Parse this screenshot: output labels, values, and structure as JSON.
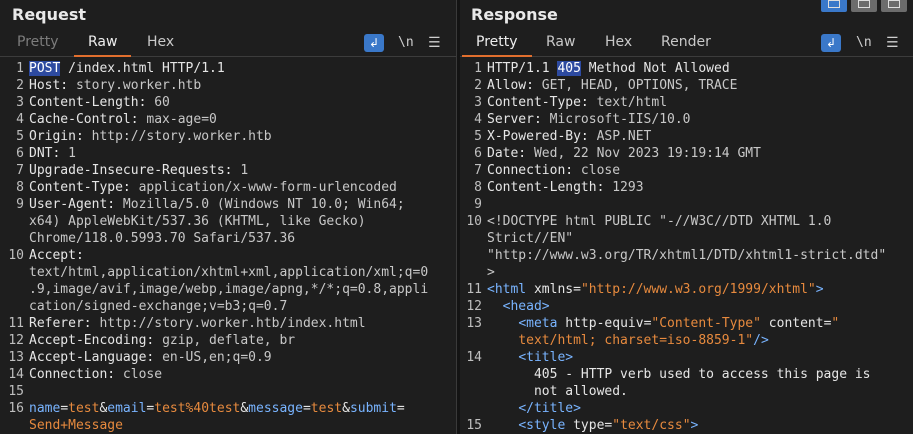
{
  "request": {
    "title": "Request",
    "tabs": [
      "Pretty",
      "Raw",
      "Hex"
    ],
    "active_tab": "Raw",
    "newline_label": "\\n",
    "lines": [
      {
        "n": "1",
        "segs": [
          {
            "t": "POST",
            "c": "hl"
          },
          {
            "t": " /index.html HTTP/1.1",
            "c": "k"
          }
        ]
      },
      {
        "n": "2",
        "segs": [
          {
            "t": "Host: ",
            "c": "k"
          },
          {
            "t": "story.worker.htb",
            "c": "v"
          }
        ]
      },
      {
        "n": "3",
        "segs": [
          {
            "t": "Content-Length: ",
            "c": "k"
          },
          {
            "t": "60",
            "c": "v"
          }
        ]
      },
      {
        "n": "4",
        "segs": [
          {
            "t": "Cache-Control: ",
            "c": "k"
          },
          {
            "t": "max-age=0",
            "c": "v"
          }
        ]
      },
      {
        "n": "5",
        "segs": [
          {
            "t": "Origin: ",
            "c": "k"
          },
          {
            "t": "http://story.worker.htb",
            "c": "v"
          }
        ]
      },
      {
        "n": "6",
        "segs": [
          {
            "t": "DNT: ",
            "c": "k"
          },
          {
            "t": "1",
            "c": "v"
          }
        ]
      },
      {
        "n": "7",
        "segs": [
          {
            "t": "Upgrade-Insecure-Requests: ",
            "c": "k"
          },
          {
            "t": "1",
            "c": "v"
          }
        ]
      },
      {
        "n": "8",
        "segs": [
          {
            "t": "Content-Type: ",
            "c": "k"
          },
          {
            "t": "application/x-www-form-urlencoded",
            "c": "v"
          }
        ]
      },
      {
        "n": "9",
        "segs": [
          {
            "t": "User-Agent: ",
            "c": "k"
          },
          {
            "t": "Mozilla/5.0 (Windows NT 10.0; Win64;",
            "c": "v"
          }
        ]
      },
      {
        "n": "",
        "segs": [
          {
            "t": "x64) AppleWebKit/537.36 (KHTML, like Gecko)",
            "c": "v"
          }
        ]
      },
      {
        "n": "",
        "segs": [
          {
            "t": "Chrome/118.0.5993.70 Safari/537.36",
            "c": "v"
          }
        ]
      },
      {
        "n": "10",
        "segs": [
          {
            "t": "Accept:",
            "c": "k"
          }
        ]
      },
      {
        "n": "",
        "segs": [
          {
            "t": "text/html,application/xhtml+xml,application/xml;q=0",
            "c": "v"
          }
        ]
      },
      {
        "n": "",
        "segs": [
          {
            "t": ".9,image/avif,image/webp,image/apng,*/*;q=0.8,appli",
            "c": "v"
          }
        ]
      },
      {
        "n": "",
        "segs": [
          {
            "t": "cation/signed-exchange;v=b3;q=0.7",
            "c": "v"
          }
        ]
      },
      {
        "n": "11",
        "segs": [
          {
            "t": "Referer: ",
            "c": "k"
          },
          {
            "t": "http://story.worker.htb/index.html",
            "c": "v"
          }
        ]
      },
      {
        "n": "12",
        "segs": [
          {
            "t": "Accept-Encoding: ",
            "c": "k"
          },
          {
            "t": "gzip, deflate, br",
            "c": "v"
          }
        ]
      },
      {
        "n": "13",
        "segs": [
          {
            "t": "Accept-Language: ",
            "c": "k"
          },
          {
            "t": "en-US,en;q=0.9",
            "c": "v"
          }
        ]
      },
      {
        "n": "14",
        "segs": [
          {
            "t": "Connection: ",
            "c": "k"
          },
          {
            "t": "close",
            "c": "v"
          }
        ]
      },
      {
        "n": "15",
        "segs": []
      },
      {
        "n": "16",
        "segs": [
          {
            "t": "name",
            "c": "pn"
          },
          {
            "t": "=",
            "c": "k"
          },
          {
            "t": "test",
            "c": "pv"
          },
          {
            "t": "&",
            "c": "k"
          },
          {
            "t": "email",
            "c": "pn"
          },
          {
            "t": "=",
            "c": "k"
          },
          {
            "t": "test%40test",
            "c": "pv"
          },
          {
            "t": "&",
            "c": "k"
          },
          {
            "t": "message",
            "c": "pn"
          },
          {
            "t": "=",
            "c": "k"
          },
          {
            "t": "test",
            "c": "pv"
          },
          {
            "t": "&",
            "c": "k"
          },
          {
            "t": "submit",
            "c": "pn"
          },
          {
            "t": "=",
            "c": "k"
          }
        ]
      },
      {
        "n": "",
        "segs": [
          {
            "t": "Send+Message",
            "c": "pv"
          }
        ]
      }
    ]
  },
  "response": {
    "title": "Response",
    "tabs": [
      "Pretty",
      "Raw",
      "Hex",
      "Render"
    ],
    "active_tab": "Pretty",
    "newline_label": "\\n",
    "lines": [
      {
        "n": "1",
        "segs": [
          {
            "t": "HTTP/1.1 ",
            "c": "k"
          },
          {
            "t": "405",
            "c": "hl"
          },
          {
            "t": " Method Not Allowed",
            "c": "k"
          }
        ]
      },
      {
        "n": "2",
        "segs": [
          {
            "t": "Allow: ",
            "c": "k"
          },
          {
            "t": "GET, HEAD, OPTIONS, TRACE",
            "c": "v"
          }
        ]
      },
      {
        "n": "3",
        "segs": [
          {
            "t": "Content-Type: ",
            "c": "k"
          },
          {
            "t": "text/html",
            "c": "v"
          }
        ]
      },
      {
        "n": "4",
        "segs": [
          {
            "t": "Server: ",
            "c": "k"
          },
          {
            "t": "Microsoft-IIS/10.0",
            "c": "v"
          }
        ]
      },
      {
        "n": "5",
        "segs": [
          {
            "t": "X-Powered-By: ",
            "c": "k"
          },
          {
            "t": "ASP.NET",
            "c": "v"
          }
        ]
      },
      {
        "n": "6",
        "segs": [
          {
            "t": "Date: ",
            "c": "k"
          },
          {
            "t": "Wed, 22 Nov 2023 19:19:14 GMT",
            "c": "v"
          }
        ]
      },
      {
        "n": "7",
        "segs": [
          {
            "t": "Connection: ",
            "c": "k"
          },
          {
            "t": "close",
            "c": "v"
          }
        ]
      },
      {
        "n": "8",
        "segs": [
          {
            "t": "Content-Length: ",
            "c": "k"
          },
          {
            "t": "1293",
            "c": "v"
          }
        ]
      },
      {
        "n": "9",
        "segs": []
      },
      {
        "n": "10",
        "segs": [
          {
            "t": "<!DOCTYPE html PUBLIC \"-//W3C//DTD XHTML 1.0",
            "c": "v"
          }
        ]
      },
      {
        "n": "",
        "segs": [
          {
            "t": "Strict//EN\"",
            "c": "v"
          }
        ]
      },
      {
        "n": "",
        "segs": [
          {
            "t": "\"http://www.w3.org/TR/xhtml1/DTD/xhtml1-strict.dtd\"",
            "c": "v"
          }
        ]
      },
      {
        "n": "",
        "segs": [
          {
            "t": ">",
            "c": "v"
          }
        ]
      },
      {
        "n": "11",
        "segs": [
          {
            "t": "<html ",
            "c": "tag"
          },
          {
            "t": "xmlns",
            "c": "attr"
          },
          {
            "t": "=",
            "c": "k"
          },
          {
            "t": "\"http://www.w3.org/1999/xhtml\"",
            "c": "str"
          },
          {
            "t": ">",
            "c": "tag"
          }
        ]
      },
      {
        "n": "12",
        "segs": [
          {
            "t": "  ",
            "c": "k"
          },
          {
            "t": "<head>",
            "c": "tag"
          }
        ]
      },
      {
        "n": "13",
        "segs": [
          {
            "t": "    ",
            "c": "k"
          },
          {
            "t": "<meta ",
            "c": "tag"
          },
          {
            "t": "http-equiv",
            "c": "attr"
          },
          {
            "t": "=",
            "c": "k"
          },
          {
            "t": "\"Content-Type\"",
            "c": "str"
          },
          {
            "t": " content",
            "c": "attr"
          },
          {
            "t": "=",
            "c": "k"
          },
          {
            "t": "\"",
            "c": "str"
          }
        ]
      },
      {
        "n": "",
        "segs": [
          {
            "t": "    ",
            "c": "k"
          },
          {
            "t": "text/html; charset=iso-8859-1\"",
            "c": "str"
          },
          {
            "t": "/>",
            "c": "tag"
          }
        ]
      },
      {
        "n": "14",
        "segs": [
          {
            "t": "    ",
            "c": "k"
          },
          {
            "t": "<title>",
            "c": "tag"
          }
        ]
      },
      {
        "n": "",
        "segs": [
          {
            "t": "      405 - HTTP verb used to access this page is",
            "c": "k"
          }
        ]
      },
      {
        "n": "",
        "segs": [
          {
            "t": "      not allowed.",
            "c": "k"
          }
        ]
      },
      {
        "n": "",
        "segs": [
          {
            "t": "    ",
            "c": "k"
          },
          {
            "t": "</title>",
            "c": "tag"
          }
        ]
      },
      {
        "n": "15",
        "segs": [
          {
            "t": "    ",
            "c": "k"
          },
          {
            "t": "<style ",
            "c": "tag"
          },
          {
            "t": "type",
            "c": "attr"
          },
          {
            "t": "=",
            "c": "k"
          },
          {
            "t": "\"text/css\"",
            "c": "str"
          },
          {
            "t": ">",
            "c": "tag"
          }
        ]
      }
    ]
  },
  "colors": {
    "accent": "#e26f2e",
    "highlight": "#2d4aa0",
    "button": "#3a78c9"
  },
  "icons": [
    "wrap-lines-icon",
    "hamburger-menu-icon",
    "layout-split-icon"
  ]
}
